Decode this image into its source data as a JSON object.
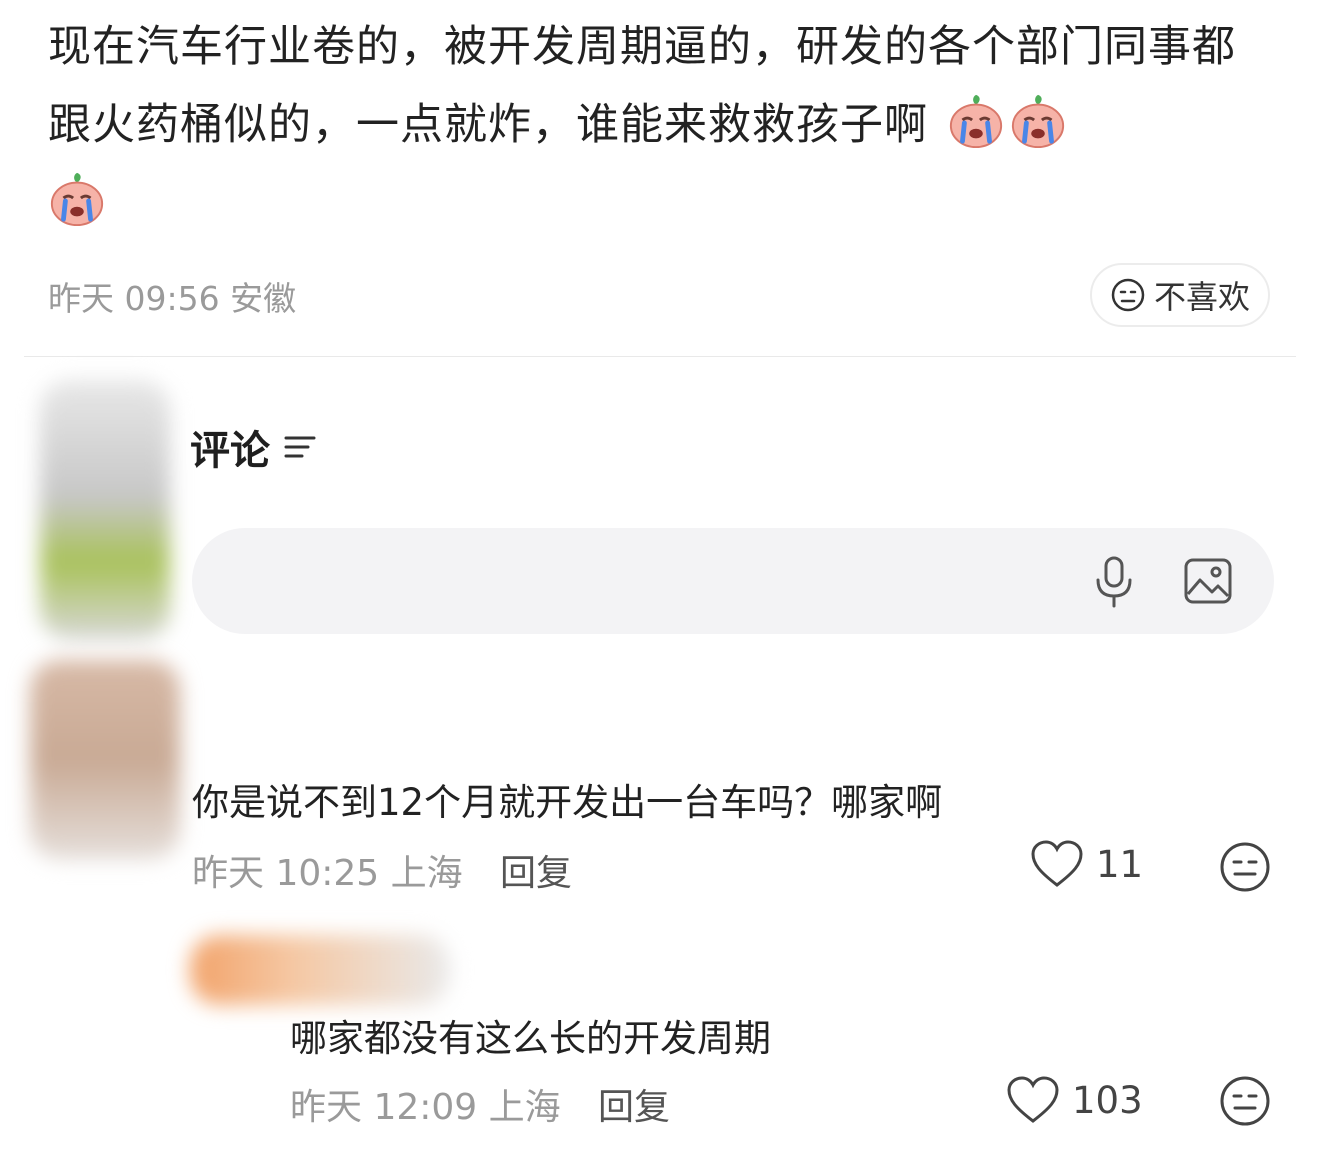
{
  "post": {
    "text": "现在汽车行业卷的，被开发周期逼的，研发的各个部门同事都跟火药桶似的，一点就炸，谁能来救救孩子啊",
    "emoji_icon": "crying-peach-emoji",
    "emoji_count": 3,
    "time": "昨天 09:56 安徽",
    "dislike_label": "不喜欢"
  },
  "comments_header": {
    "title": "评论",
    "sort_icon": "sort-lines-icon"
  },
  "comment_input": {
    "placeholder": "",
    "mic_icon": "microphone-icon",
    "image_icon": "image-icon"
  },
  "comments": [
    {
      "text": "你是说不到12个月就开发出一台车吗？哪家啊",
      "time": "昨天 10:25 上海",
      "reply_label": "回复",
      "likes": "11"
    },
    {
      "text": "哪家都没有这么长的开发周期",
      "time": "昨天 12:09 上海",
      "reply_label": "回复",
      "likes": "103"
    }
  ],
  "colors": {
    "emoji_face": "#f6b3a8",
    "emoji_leaf": "#4fae5a",
    "tear": "#4a86e8",
    "meta_gray": "#9a9a9a",
    "input_bg": "#f3f3f5"
  }
}
